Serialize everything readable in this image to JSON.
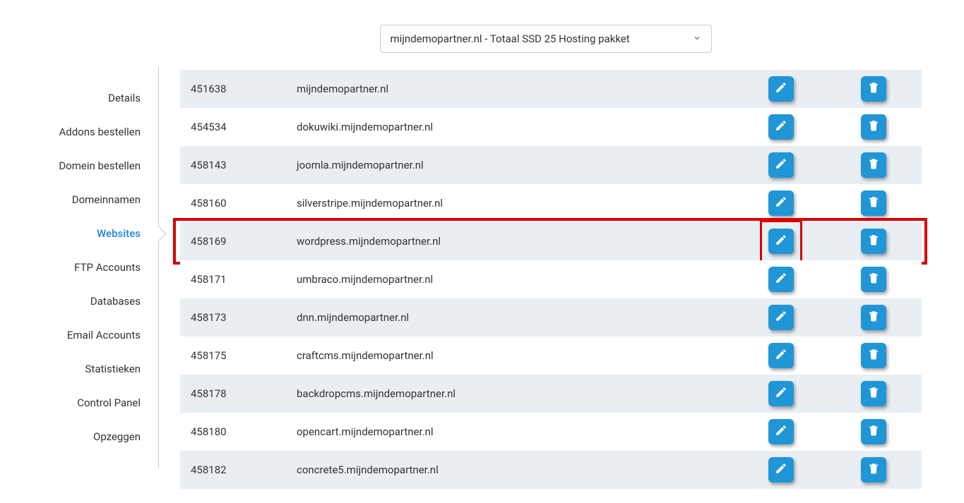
{
  "dropdown": {
    "selected": "mijndemopartner.nl - Totaal SSD 25 Hosting pakket"
  },
  "sidebar": {
    "items": [
      {
        "label": "Details",
        "active": false
      },
      {
        "label": "Addons bestellen",
        "active": false
      },
      {
        "label": "Domein bestellen",
        "active": false
      },
      {
        "label": "Domeinnamen",
        "active": false
      },
      {
        "label": "Websites",
        "active": true
      },
      {
        "label": "FTP Accounts",
        "active": false
      },
      {
        "label": "Databases",
        "active": false
      },
      {
        "label": "Email Accounts",
        "active": false
      },
      {
        "label": "Statistieken",
        "active": false
      },
      {
        "label": "Control Panel",
        "active": false
      },
      {
        "label": "Opzeggen",
        "active": false
      }
    ]
  },
  "rows": [
    {
      "id": "451638",
      "domain": "mijndemopartner.nl",
      "highlighted": false
    },
    {
      "id": "454534",
      "domain": "dokuwiki.mijndemopartner.nl",
      "highlighted": false
    },
    {
      "id": "458143",
      "domain": "joomla.mijndemopartner.nl",
      "highlighted": false
    },
    {
      "id": "458160",
      "domain": "silverstripe.mijndemopartner.nl",
      "highlighted": false
    },
    {
      "id": "458169",
      "domain": "wordpress.mijndemopartner.nl",
      "highlighted": true
    },
    {
      "id": "458171",
      "domain": "umbraco.mijndemopartner.nl",
      "highlighted": false
    },
    {
      "id": "458173",
      "domain": "dnn.mijndemopartner.nl",
      "highlighted": false
    },
    {
      "id": "458175",
      "domain": "craftcms.mijndemopartner.nl",
      "highlighted": false
    },
    {
      "id": "458178",
      "domain": "backdropcms.mijndemopartner.nl",
      "highlighted": false
    },
    {
      "id": "458180",
      "domain": "opencart.mijndemopartner.nl",
      "highlighted": false
    },
    {
      "id": "458182",
      "domain": "concrete5.mijndemopartner.nl",
      "highlighted": false
    }
  ],
  "colors": {
    "accent": "#2196d6",
    "highlight": "#d70000"
  }
}
